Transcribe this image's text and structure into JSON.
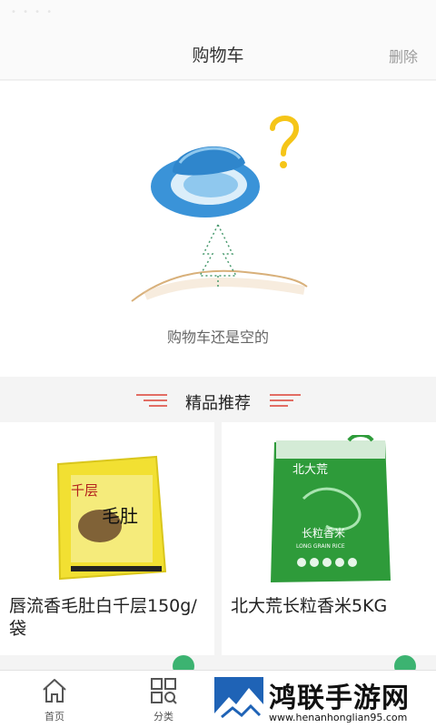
{
  "nav": {
    "title": "购物车",
    "delete_label": "删除"
  },
  "cart": {
    "empty_text": "购物车还是空的"
  },
  "recommend": {
    "title": "精品推荐",
    "products": [
      {
        "name": "唇流香毛肚白千层150g/袋",
        "image_label_1": "千层",
        "image_label_2": "毛肚"
      },
      {
        "name": "北大荒长粒香米5KG",
        "image_brand": "北大荒",
        "image_label": "长粒香米",
        "image_sub": "LONG GRAIN RICE"
      }
    ]
  },
  "tabs": [
    {
      "label": "首页",
      "icon": "home-icon"
    },
    {
      "label": "分类",
      "icon": "category-icon"
    }
  ],
  "watermark": {
    "title": "鸿联手游网",
    "url": "www.henanhonglian95.com"
  },
  "colors": {
    "accent_red": "#e05a4f",
    "hat_blue": "#3a93d8",
    "question_yellow": "#f5c518",
    "rice_green": "#2e9b3a"
  }
}
